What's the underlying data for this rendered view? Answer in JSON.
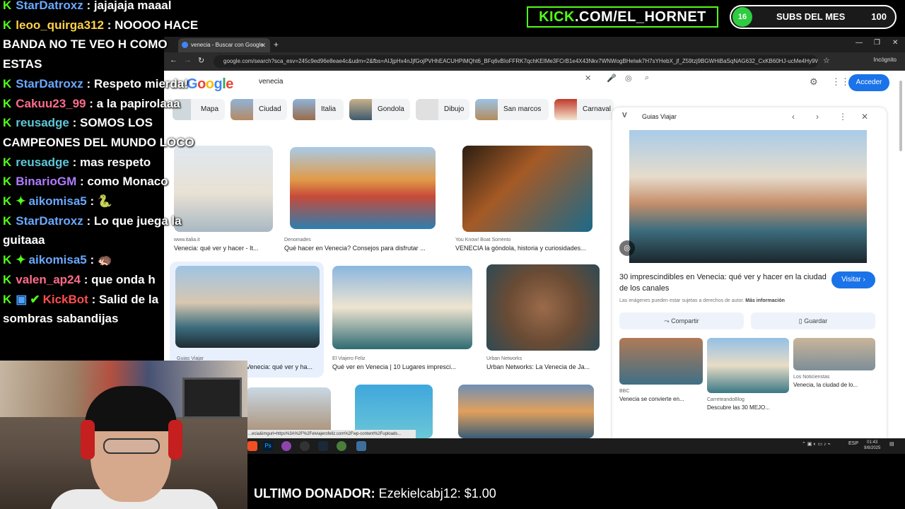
{
  "chat": [
    {
      "user": "StarDatroxz",
      "msg": ": jajajaja maaal",
      "color": "#6aa8ff",
      "badges": [
        "kick"
      ]
    },
    {
      "user": "leoo_quirga312",
      "msg": ": NOOOO HACE",
      "color": "#ffd24a",
      "badges": [
        "kick"
      ]
    },
    {
      "user": "",
      "msg": "BANDA NO TE VEO H COMO",
      "color": "#ffffff",
      "badges": []
    },
    {
      "user": "",
      "msg": "ESTAS",
      "color": "#ffffff",
      "badges": []
    },
    {
      "user": "StarDatroxz",
      "msg": ": Respeto mierda!",
      "color": "#6aa8ff",
      "badges": [
        "kick"
      ]
    },
    {
      "user": "Cakuu23_99",
      "msg": ": a la papirolaaa",
      "color": "#ff6b8a",
      "badges": [
        "kick"
      ]
    },
    {
      "user": "reusadge",
      "msg": ": SOMOS LOS",
      "color": "#5ec8d8",
      "badges": [
        "kick"
      ]
    },
    {
      "user": "",
      "msg": "CAMPEONES DEL MUNDO LOCO",
      "color": "#ffffff",
      "badges": []
    },
    {
      "user": "reusadge",
      "msg": ": mas respeto",
      "color": "#5ec8d8",
      "badges": [
        "kick"
      ]
    },
    {
      "user": "BinarioGM",
      "msg": ": como Monaco",
      "color": "#b07cff",
      "badges": [
        "kick"
      ]
    },
    {
      "user": "aikomisa5",
      "msg": ": 🐍",
      "color": "#6aa8ff",
      "badges": [
        "kick",
        "mod"
      ]
    },
    {
      "user": "StarDatroxz",
      "msg": ": Lo que juega la",
      "color": "#6aa8ff",
      "badges": [
        "kick"
      ]
    },
    {
      "user": "",
      "msg": "guitaaa",
      "color": "#ffffff",
      "badges": []
    },
    {
      "user": "aikomisa5",
      "msg": ": 🦔",
      "color": "#6aa8ff",
      "badges": [
        "kick",
        "mod"
      ]
    },
    {
      "user": "valen_ap24",
      "msg": ": que onda h",
      "color": "#ff6b8a",
      "badges": [
        "kick"
      ]
    },
    {
      "user": "KickBot",
      "msg": ": Salid de la",
      "color": "#ff4d4d",
      "badges": [
        "kick",
        "box",
        "check"
      ]
    },
    {
      "user": "",
      "msg": "sombras sabandijas",
      "color": "#ffffff",
      "badges": []
    }
  ],
  "kick_banner": {
    "prefix": "KICK",
    "suffix": ".COM/EL_HORNET",
    "accent": "#53fc18"
  },
  "subs": {
    "count": "16",
    "label": "SUBS DEL MES",
    "goal": "100"
  },
  "donor": {
    "label": "ULTIMO DONADOR:",
    "value": "Ezekielcabj12: $1.00"
  },
  "browser": {
    "tab_title": "venecia - Buscar con Google",
    "url": "google.com/search?sca_esv=245c9ed96e8eae4c&udm=2&fbs=AIJjpHx4nJjfGojPVHhEACUHPiMQht6_BFq6vBIoFFRK7qchKEIMe3FCrB1e4X43Nkv7WNWogBHeIwk7H7sYHebX_jf_Z59tzj9BGWHiBaSqNAG632_CxKB60HJ-ucMe4Hy9WaXP8WNLecuFqC...",
    "incognito": "Incógnito",
    "search_query": "venecia",
    "sign_in": "Acceder",
    "status_url": "...ecia&imgurl=https%3A%2F%2Felviajerofeliz.com%2Fwp-content%2Fuploads..."
  },
  "chips": [
    "Mapa",
    "Ciudad",
    "Italia",
    "Gondola",
    "Dibujo",
    "San marcos",
    "Carnaval"
  ],
  "results": [
    {
      "source": "www.italia.it",
      "title": "Venecia: qué ver y hacer - It..."
    },
    {
      "source": "Denomades",
      "title": "Qué hacer en Venecia? Consejos para disfrutar ..."
    },
    {
      "source": "You Know! Boat Sorrento",
      "title": "VENECIA la góndola, historia y curiosidades..."
    },
    {
      "source": "Guias Viajar",
      "title": "Venecia: qué ver y ha..."
    },
    {
      "source": "El Viajero Feliz",
      "title": "Qué ver en Venecia | 10 Lugares impresci..."
    },
    {
      "source": "Urban Networks",
      "title": "Urban Networks: La Venecia de Ja..."
    }
  ],
  "panel": {
    "site": "Guias Viajar",
    "title": "30 imprescindibles en Venecia: qué ver y hacer en la ciudad de los canales",
    "visit": "Visitar",
    "copyright": "Las imágenes pueden estar sujetas a derechos de autor.",
    "more_info": "Más información",
    "share": "Compartir",
    "save": "Guardar",
    "related": [
      {
        "source": "BBC",
        "title": "Venecia se convierte en..."
      },
      {
        "source": "CarreteandoBlog",
        "title": "Descubre las 30 MEJO..."
      },
      {
        "source": "Los Noticienstas",
        "title": "Venecia, la ciudad de lo..."
      }
    ]
  },
  "taskbar": {
    "lang": "ESP",
    "time": "01:43",
    "date": "9/8/2025"
  }
}
